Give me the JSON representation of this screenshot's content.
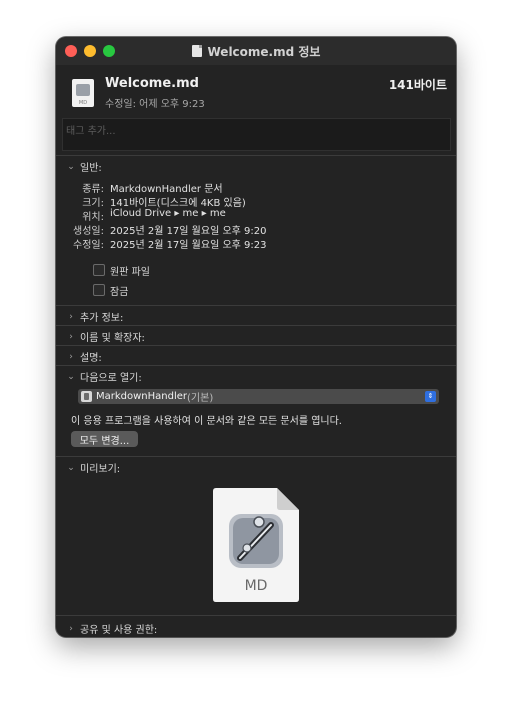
{
  "window": {
    "title": "Welcome.md 정보"
  },
  "header": {
    "filename": "Welcome.md",
    "size": "141바이트",
    "modified": "수정일: 어제 오후 9:23",
    "file_icon_label": "MD"
  },
  "tags": {
    "placeholder": "태그 추가..."
  },
  "general": {
    "title": "일반:",
    "rows": [
      {
        "key": "종류:",
        "value": "MarkdownHandler 문서"
      },
      {
        "key": "크기:",
        "value": "141바이트(디스크에 4KB 있음)"
      },
      {
        "key": "위치:",
        "value": "iCloud Drive ▸ me ▸ me"
      },
      {
        "key": "생성일:",
        "value": "2025년 2월 17일 월요일 오후 9:20"
      },
      {
        "key": "수정일:",
        "value": "2025년 2월 17일 월요일 오후 9:23"
      }
    ],
    "stationery_label": "원판 파일",
    "locked_label": "잠금"
  },
  "sections": {
    "more_info": "추가 정보:",
    "name_ext": "이름 및 확장자:",
    "comments": "설명:",
    "open_with": "다음으로 열기:",
    "preview": "미리보기:",
    "sharing": "공유 및 사용 권한:"
  },
  "open_with": {
    "app_name": "MarkdownHandler",
    "app_default": "(기본)",
    "description": "이 응용 프로그램을 사용하여 이 문서와 같은 모든 문서를 엽니다.",
    "change_all": "모두 변경..."
  },
  "preview": {
    "label": "MD"
  },
  "colors": {
    "close": "#ff5f57",
    "minimize": "#febc2e",
    "maximize": "#28c840",
    "accent": "#2f6fe0",
    "window_bg": "#232323"
  },
  "icons": {
    "expanded": "chevron-down-icon",
    "collapsed": "chevron-right-icon",
    "document": "document-icon",
    "app": "markdown-handler-app-icon",
    "popup": "popup-arrows-icon"
  }
}
